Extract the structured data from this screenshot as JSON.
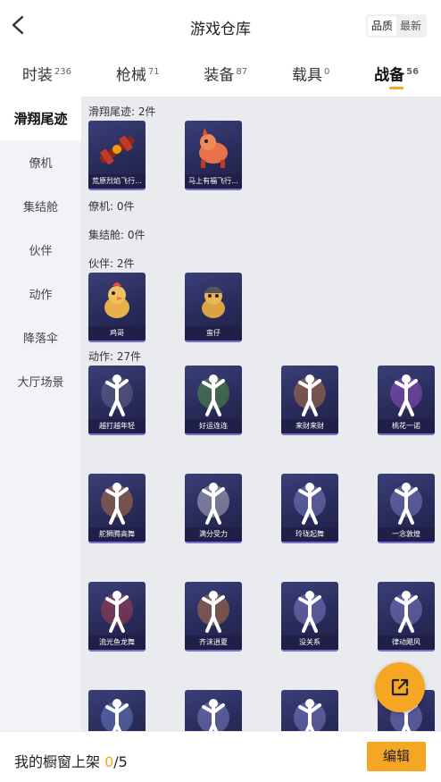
{
  "header": {
    "title": "游戏仓库",
    "sort_options": [
      "品质",
      "最新"
    ],
    "active_sort": 0
  },
  "tabs": [
    {
      "label": "时装",
      "count": "236"
    },
    {
      "label": "枪械",
      "count": "71"
    },
    {
      "label": "装备",
      "count": "87"
    },
    {
      "label": "载具",
      "count": "0"
    },
    {
      "label": "战备",
      "count": "56"
    }
  ],
  "active_tab": 4,
  "sidebar": {
    "items": [
      "滑翔尾迹",
      "僚机",
      "集结舱",
      "伙伴",
      "动作",
      "降落伞",
      "大厅场景"
    ],
    "active": 0
  },
  "sections": {
    "glide_trail": {
      "title": "滑翔尾迹: 2件",
      "items": [
        "荒原烈焰飞行...",
        "马上有福飞行..."
      ]
    },
    "wingman": {
      "title": "僚机: 0件"
    },
    "assembly": {
      "title": "集结舱: 0件"
    },
    "partner": {
      "title": "伙伴: 2件",
      "items": [
        "鸡哥",
        "蛮仔"
      ]
    },
    "emote": {
      "title": "动作: 27件",
      "items": [
        "越打越年轻",
        "好运连连",
        "来财来财",
        "桃花一诺",
        "舵狮腾高舞",
        "满分受力",
        "玲珑起舞",
        "一念敦煌",
        "流光鱼龙舞",
        "齐沫逍夏",
        "没关系",
        "律动飓风",
        "",
        "",
        "",
        ""
      ]
    }
  },
  "bottom": {
    "shelf_label": "我的橱窗上架 ",
    "shelf_current": "0",
    "shelf_total": "/5",
    "edit_label": "编辑"
  },
  "colors": {
    "accent": "#f5a623",
    "card_bg": "#2a2d5c"
  }
}
